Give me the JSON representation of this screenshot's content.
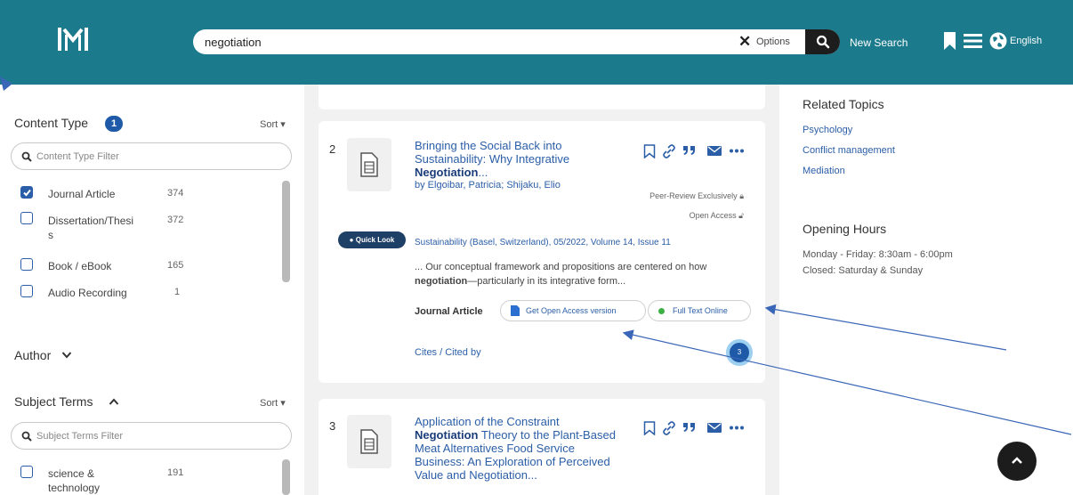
{
  "header": {
    "search_query": "negotiation",
    "clear_icon": "close-icon",
    "options_label": "Options",
    "new_search_label": "New Search",
    "language_label": "English",
    "colors": {
      "header_bg": "#1b7a8c",
      "link": "#2b5ea7",
      "badge": "#1e5aa8"
    }
  },
  "sidebar": {
    "content_type": {
      "title": "Content Type",
      "badge": "1",
      "sort_label": "Sort",
      "filter_placeholder": "Content Type Filter",
      "items": [
        {
          "label": "Journal Article",
          "count": "374",
          "checked": true
        },
        {
          "label": "Dissertation/Thesi",
          "label2": "s",
          "count": "372",
          "checked": false
        },
        {
          "label": "Book / eBook",
          "count": "165",
          "checked": false
        },
        {
          "label": "Audio Recording",
          "count": "1",
          "checked": false
        }
      ]
    },
    "author": {
      "title": "Author"
    },
    "subject_terms": {
      "title": "Subject Terms",
      "sort_label": "Sort",
      "filter_placeholder": "Subject Terms Filter",
      "items": [
        {
          "label": "science &",
          "label2": "technology",
          "count": "191",
          "checked": false
        }
      ]
    }
  },
  "results": [
    {
      "number": "2",
      "title_pre": "Bringing the Social Back into Sustainability: Why Integrative",
      "title_bold": "Negotiation",
      "title_post": "...",
      "authors": "by Elgoibar, Patricia; Shijaku, Elio",
      "peer_review": "Peer-Review Exclusively",
      "open_access": "Open Access",
      "quick_look": "Quick Look",
      "source": "Sustainability (Basel, Switzerland), 05/2022, Volume 14, Issue 11",
      "snippet_pre": "... Our conceptual framework and propositions are centered on how",
      "snippet_bold": "negotiation",
      "snippet_post": "—particularly in its integrative form...",
      "doc_type": "Journal Article",
      "oa_button": "Get Open Access version",
      "fulltext_button": "Full Text Online",
      "cites": "Cites / Cited by",
      "ring_badge": "3"
    },
    {
      "number": "3",
      "title_pre": "Application of the Constraint",
      "title_bold": "Negotiation",
      "title_post": "Theory to the Plant-Based Meat Alternatives Food Service Business: An Exploration of Perceived Value and Negotiation..."
    }
  ],
  "right_panel": {
    "related_title": "Related Topics",
    "topics": [
      "Psychology",
      "Conflict management",
      "Mediation"
    ],
    "hours_title": "Opening Hours",
    "hours": [
      "Monday - Friday: 8:30am - 6:00pm",
      "Closed: Saturday & Sunday"
    ]
  }
}
